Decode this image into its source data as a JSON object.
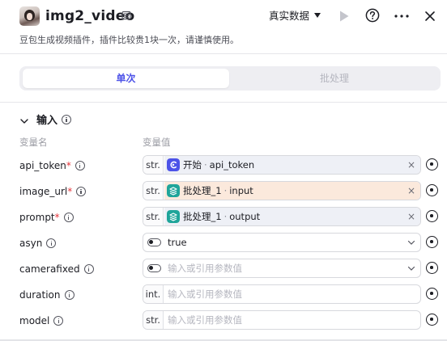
{
  "header": {
    "title": "img2_video",
    "run_mode": "真实数据",
    "description": "豆包生成视频插件，插件比较贵1块一次，请谨慎使用。"
  },
  "tabs": {
    "single": "单次",
    "batch": "批处理"
  },
  "input_section": {
    "title": "输入",
    "col_variable_name": "变量名",
    "col_variable_value": "变量值",
    "rows": [
      {
        "name": "api_token",
        "required": "*",
        "type": "str.",
        "ref_source": "开始",
        "ref_field": "api_token",
        "ref_icon": "start-icon"
      },
      {
        "name": "image_url",
        "required": "*",
        "type": "str.",
        "ref_source": "批处理_1",
        "ref_field": "input",
        "ref_icon": "batch-icon"
      },
      {
        "name": "prompt",
        "required": "*",
        "type": "str.",
        "ref_source": "批处理_1",
        "ref_field": "output",
        "ref_icon": "batch-icon"
      },
      {
        "name": "asyn",
        "value": "true"
      },
      {
        "name": "camerafixed",
        "placeholder": "输入或引用参数值"
      },
      {
        "name": "duration",
        "type": "int.",
        "placeholder": "输入或引用参数值"
      },
      {
        "name": "model",
        "type": "str.",
        "placeholder": "输入或引用参数值"
      }
    ]
  },
  "colors": {
    "accent": "#4d53e8",
    "required": "#e5343a",
    "ref_highlight": "#fbe9dc",
    "batch_icon": "#1fa59a",
    "start_icon": "#4d53e8"
  }
}
